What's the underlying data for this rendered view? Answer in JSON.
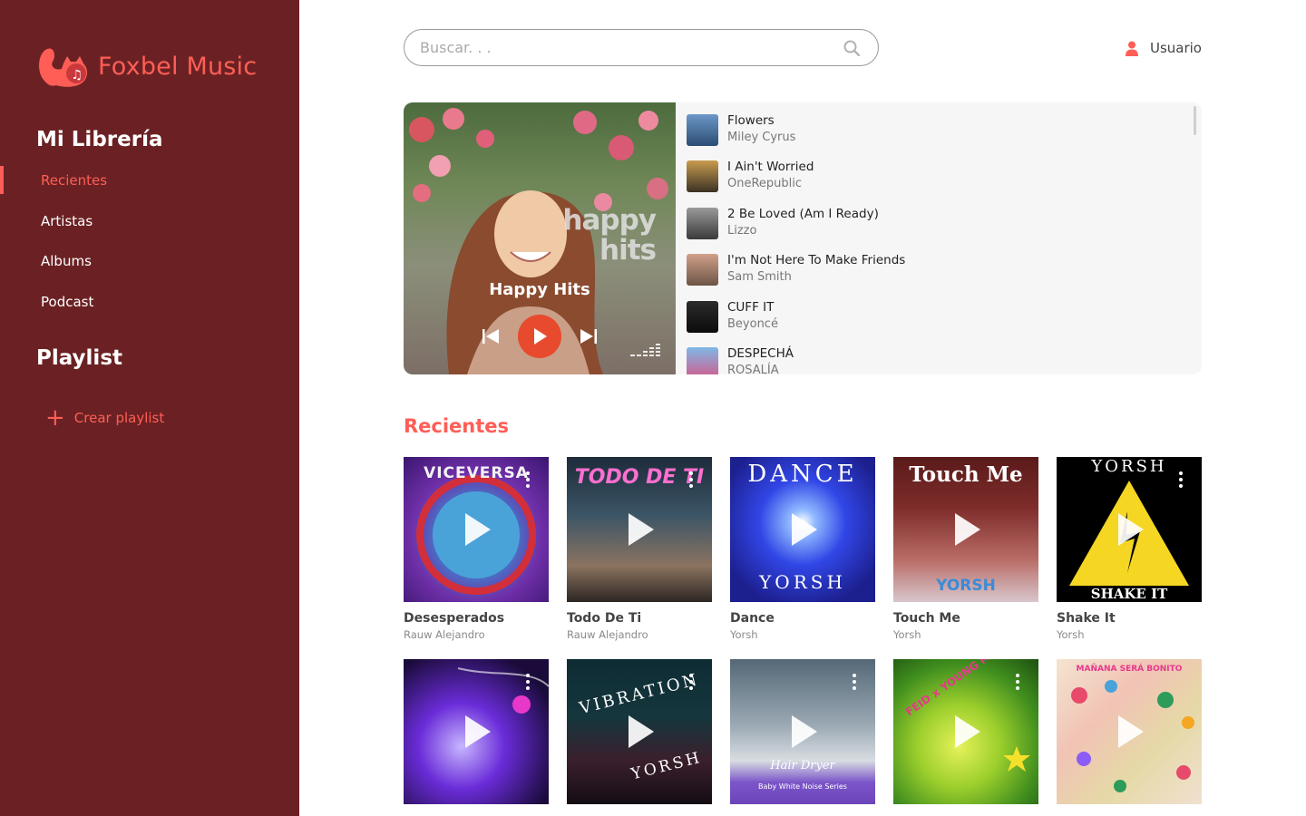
{
  "brand": {
    "name": "Foxbel Music",
    "accent": "#ff5e57",
    "sidebar_bg": "#6b2123",
    "play_color": "#e84a2d"
  },
  "sidebar": {
    "library_title": "Mi Librería",
    "items": [
      {
        "label": "Recientes",
        "active": true
      },
      {
        "label": "Artistas",
        "active": false
      },
      {
        "label": "Albums",
        "active": false
      },
      {
        "label": "Podcast",
        "active": false
      }
    ],
    "playlist_title": "Playlist",
    "create_playlist": "Crear playlist"
  },
  "search": {
    "placeholder": "Buscar. . ."
  },
  "user": {
    "label": "Usuario"
  },
  "featured": {
    "title": "Happy Hits",
    "cover_tag_line1": "happy",
    "cover_tag_line2": "hits",
    "tracks": [
      {
        "title": "Flowers",
        "artist": "Miley Cyrus"
      },
      {
        "title": "I Ain't Worried",
        "artist": "OneRepublic"
      },
      {
        "title": "2 Be Loved (Am I Ready)",
        "artist": "Lizzo"
      },
      {
        "title": "I'm Not Here To Make Friends",
        "artist": "Sam Smith"
      },
      {
        "title": "CUFF IT",
        "artist": "Beyoncé"
      },
      {
        "title": "DESPECHÁ",
        "artist": "ROSALÍA"
      }
    ]
  },
  "recientes": {
    "title": "Recientes",
    "row1": [
      {
        "title": "Desesperados",
        "artist": "Rauw Alejandro",
        "cover_text": "VICEVERSA"
      },
      {
        "title": "Todo De Ti",
        "artist": "Rauw Alejandro",
        "cover_text": "TODO DE TI"
      },
      {
        "title": "Dance",
        "artist": "Yorsh",
        "cover_text": "DANCE",
        "cover_text_2": "YORSH"
      },
      {
        "title": "Touch Me",
        "artist": "Yorsh",
        "cover_text": "Touch Me",
        "cover_text_2": "YORSH"
      },
      {
        "title": "Shake It",
        "artist": "Yorsh",
        "cover_text": "YORSH",
        "cover_text_2": "SHAKE IT"
      }
    ],
    "row2": [
      {
        "cover_text": ""
      },
      {
        "cover_text": "VIBRATION",
        "cover_text_2": "YORSH"
      },
      {
        "cover_text": "Hair Dryer",
        "cover_text_2": "Baby White Noise Series"
      },
      {
        "cover_text": "FEID x YOUNG MIKO"
      },
      {
        "cover_text": "MAÑANA SERÁ BONITO"
      }
    ]
  }
}
